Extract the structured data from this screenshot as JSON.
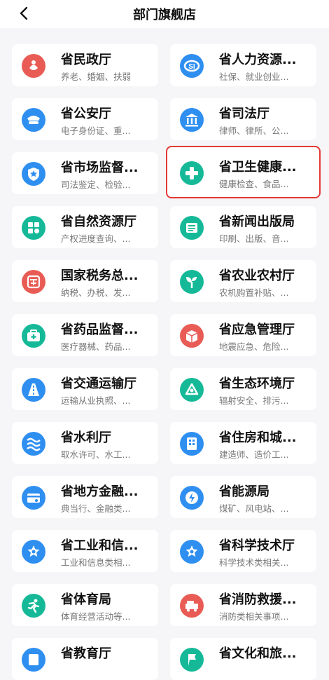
{
  "header": {
    "title": "部门旗舰店",
    "back_icon": "chevron-left-icon"
  },
  "cards": [
    {
      "name": "省民政厅",
      "desc": "养老、婚姻、扶弱",
      "icon": "hands-heart-icon",
      "color": "#e85c55"
    },
    {
      "name": "省人力资源...",
      "desc": "社保、就业创业...",
      "icon": "si-badge-icon",
      "color": "#2f8ff0"
    },
    {
      "name": "省公安厅",
      "desc": "电子身份证、重...",
      "icon": "police-cap-icon",
      "color": "#2f8ff0"
    },
    {
      "name": "省司法厅",
      "desc": "律师、律所、公...",
      "icon": "courthouse-icon",
      "color": "#2f8ff0"
    },
    {
      "name": "省市场监督...",
      "desc": "司法鉴定、检验...",
      "icon": "shield-star-icon",
      "color": "#2f8ff0"
    },
    {
      "name": "省卫生健康...",
      "desc": "健康检查、食品...",
      "icon": "medical-cross-icon",
      "color": "#15b998"
    },
    {
      "name": "省自然资源厅",
      "desc": "产权进度查询、...",
      "icon": "land-map-icon",
      "color": "#15b998"
    },
    {
      "name": "省新闻出版局",
      "desc": "印刷、出版、音...",
      "icon": "newspaper-icon",
      "color": "#15b998"
    },
    {
      "name": "国家税务总...",
      "desc": "纳税、办税、发...",
      "icon": "tax-icon",
      "color": "#e85c55"
    },
    {
      "name": "省农业农村厅",
      "desc": "农机购置补贴、...",
      "icon": "sprout-icon",
      "color": "#15b998"
    },
    {
      "name": "省药品监督...",
      "desc": "医疗器械、药品...",
      "icon": "medicine-box-icon",
      "color": "#15b998"
    },
    {
      "name": "省应急管理厅",
      "desc": "地震应急、危险...",
      "icon": "emergency-box-icon",
      "color": "#e85c55"
    },
    {
      "name": "省交通运输厅",
      "desc": "运输从业执照、...",
      "icon": "road-icon",
      "color": "#2f8ff0"
    },
    {
      "name": "省生态环境厅",
      "desc": "辐射安全、排污...",
      "icon": "recycle-icon",
      "color": "#15b998"
    },
    {
      "name": "省水利厅",
      "desc": "取水许可、水工...",
      "icon": "water-waves-icon",
      "color": "#2f8ff0"
    },
    {
      "name": "省住房和城...",
      "desc": "建造师、造价工...",
      "icon": "building-icon",
      "color": "#2f8ff0"
    },
    {
      "name": "省地方金融...",
      "desc": "典当行、金融类...",
      "icon": "finance-card-icon",
      "color": "#2f8ff0"
    },
    {
      "name": "省能源局",
      "desc": "煤矿、风电站、...",
      "icon": "energy-bolt-icon",
      "color": "#2f8ff0"
    },
    {
      "name": "省工业和信...",
      "desc": "工业和信息类相...",
      "icon": "industry-star-icon",
      "color": "#2f8ff0"
    },
    {
      "name": "省科学技术厅",
      "desc": "科学技术类相关...",
      "icon": "science-star-icon",
      "color": "#2f8ff0"
    },
    {
      "name": "省体育局",
      "desc": "体育经营活动等...",
      "icon": "runner-icon",
      "color": "#15b998"
    },
    {
      "name": "省消防救援...",
      "desc": "消防类相关事项...",
      "icon": "fire-truck-icon",
      "color": "#e85c55"
    },
    {
      "name": "省教育厅",
      "desc": "",
      "icon": "book-icon",
      "color": "#2f8ff0"
    },
    {
      "name": "省文化和旅...",
      "desc": "",
      "icon": "flag-icon",
      "color": "#15b998"
    }
  ],
  "highlighted_index": 5
}
